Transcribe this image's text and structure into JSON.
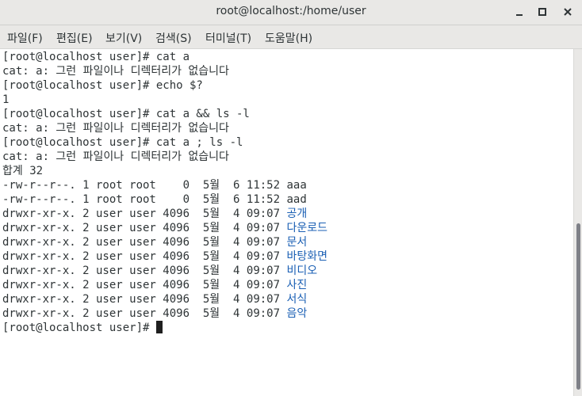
{
  "window": {
    "title": "root@localhost:/home/user"
  },
  "menu": {
    "items": [
      "파일(F)",
      "편집(E)",
      "보기(V)",
      "검색(S)",
      "터미널(T)",
      "도움말(H)"
    ]
  },
  "terminal": {
    "lines": [
      {
        "text": "[root@localhost user]# cat a"
      },
      {
        "text": "cat: a: 그런 파일이나 디렉터리가 없습니다"
      },
      {
        "text": "[root@localhost user]# echo $?"
      },
      {
        "text": "1"
      },
      {
        "text": "[root@localhost user]# cat a && ls -l"
      },
      {
        "text": "cat: a: 그런 파일이나 디렉터리가 없습니다"
      },
      {
        "text": "[root@localhost user]# cat a ; ls -l"
      },
      {
        "text": "cat: a: 그런 파일이나 디렉터리가 없습니다"
      },
      {
        "text": "합계 32"
      },
      {
        "prefix": "-rw-r--r--. 1 root root    0  5월  6 11:52 ",
        "name": "aaa",
        "dir": false
      },
      {
        "prefix": "-rw-r--r--. 1 root root    0  5월  6 11:52 ",
        "name": "aad",
        "dir": false
      },
      {
        "prefix": "drwxr-xr-x. 2 user user 4096  5월  4 09:07 ",
        "name": "공개",
        "dir": true
      },
      {
        "prefix": "drwxr-xr-x. 2 user user 4096  5월  4 09:07 ",
        "name": "다운로드",
        "dir": true
      },
      {
        "prefix": "drwxr-xr-x. 2 user user 4096  5월  4 09:07 ",
        "name": "문서",
        "dir": true
      },
      {
        "prefix": "drwxr-xr-x. 2 user user 4096  5월  4 09:07 ",
        "name": "바탕화면",
        "dir": true
      },
      {
        "prefix": "drwxr-xr-x. 2 user user 4096  5월  4 09:07 ",
        "name": "비디오",
        "dir": true
      },
      {
        "prefix": "drwxr-xr-x. 2 user user 4096  5월  4 09:07 ",
        "name": "사진",
        "dir": true
      },
      {
        "prefix": "drwxr-xr-x. 2 user user 4096  5월  4 09:07 ",
        "name": "서식",
        "dir": true
      },
      {
        "prefix": "drwxr-xr-x. 2 user user 4096  5월  4 09:07 ",
        "name": "음악",
        "dir": true
      }
    ],
    "prompt": "[root@localhost user]# "
  },
  "colors": {
    "directory": "#1a5fb4",
    "text": "#2e3436",
    "background": "#ffffff"
  },
  "icons": [
    "minimize-icon",
    "maximize-icon",
    "close-icon"
  ]
}
